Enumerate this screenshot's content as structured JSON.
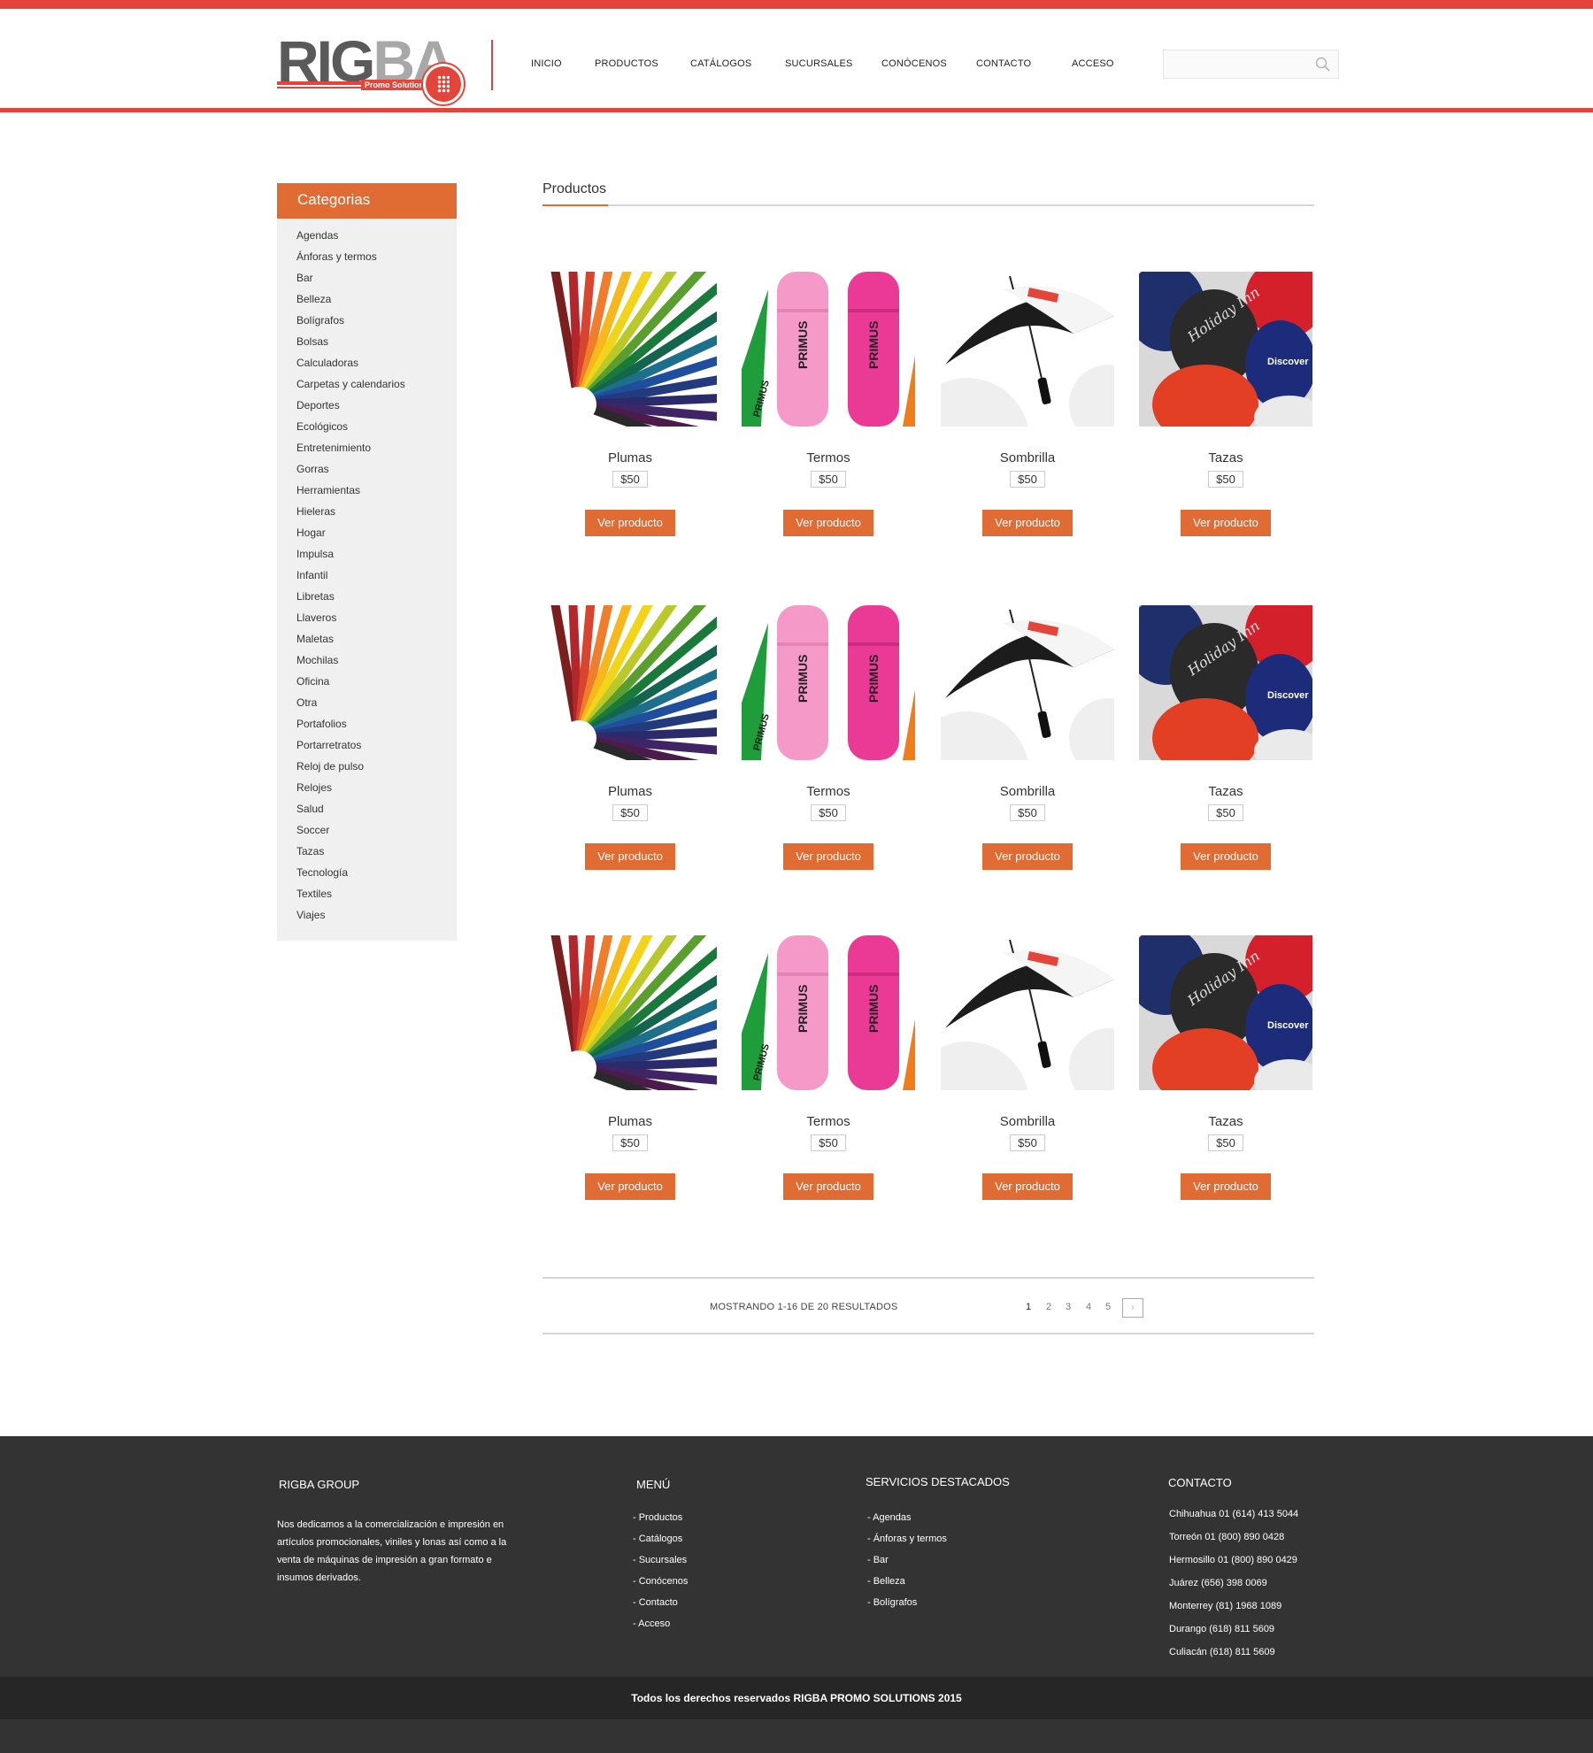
{
  "brand": {
    "name_part1": "RIG",
    "name_part2": "BA",
    "tagline": "Promo Solutions"
  },
  "colors": {
    "accent_red": "#e3453a",
    "accent_orange": "#e06b33",
    "footer_bg": "#333333"
  },
  "nav": {
    "items": [
      "INICIO",
      "PRODUCTOS",
      "CATÁLOGOS",
      "SUCURSALES",
      "CONÓCENOS",
      "CONTACTO",
      "ACCESO"
    ]
  },
  "search": {
    "placeholder": ""
  },
  "sidebar": {
    "title": "Categorias",
    "categories": [
      "Agendas",
      "Ánforas y termos",
      "Bar",
      "Belleza",
      "Bolígrafos",
      "Bolsas",
      "Calculadoras",
      "Carpetas y calendarios",
      "Deportes",
      "Ecológicos",
      "Entretenimiento",
      "Gorras",
      "Herramientas",
      "Hieleras",
      "Hogar",
      "Impulsa",
      "Infantil",
      "Libretas",
      "Llaveros",
      "Maletas",
      "Mochilas",
      "Oficina",
      "Otra",
      "Portafolios",
      "Portarretratos",
      "Reloj de pulso",
      "Relojes",
      "Salud",
      "Soccer",
      "Tazas",
      "Tecnología",
      "Textiles",
      "Viajes"
    ]
  },
  "main": {
    "title": "Productos",
    "button_label": "Ver producto",
    "products": [
      {
        "name": "Plumas",
        "price": "$50",
        "image": "colored-pencils"
      },
      {
        "name": "Termos",
        "price": "$50",
        "image": "pink-thermos"
      },
      {
        "name": "Sombrilla",
        "price": "$50",
        "image": "umbrella"
      },
      {
        "name": "Tazas",
        "price": "$50",
        "image": "mugs"
      },
      {
        "name": "Plumas",
        "price": "$50",
        "image": "colored-pencils"
      },
      {
        "name": "Termos",
        "price": "$50",
        "image": "pink-thermos"
      },
      {
        "name": "Sombrilla",
        "price": "$50",
        "image": "umbrella"
      },
      {
        "name": "Tazas",
        "price": "$50",
        "image": "mugs"
      },
      {
        "name": "Plumas",
        "price": "$50",
        "image": "colored-pencils"
      },
      {
        "name": "Termos",
        "price": "$50",
        "image": "pink-thermos"
      },
      {
        "name": "Sombrilla",
        "price": "$50",
        "image": "umbrella"
      },
      {
        "name": "Tazas",
        "price": "$50",
        "image": "mugs"
      }
    ]
  },
  "pagination": {
    "showing": "MOSTRANDO 1-16 DE 20 RESULTADOS",
    "pages": [
      "1",
      "2",
      "3",
      "4",
      "5"
    ],
    "current": "1",
    "next": "›"
  },
  "footer": {
    "about_title": "RIGBA GROUP",
    "about_text": "Nos dedicamos a la comercialización e impresión en artículos promocionales, viniles y lonas así como a la venta de máquinas de impresión a gran formato e insumos derivados.",
    "menu_title": "MENÚ",
    "menu_items": [
      "- Productos",
      "- Catálogos",
      "- Sucursales",
      "- Conócenos",
      "- Contacto",
      "- Acceso"
    ],
    "services_title": "SERVICIOS DESTACADOS",
    "services_items": [
      "- Agendas",
      "- Ánforas y termos",
      "- Bar",
      "- Belleza",
      "- Bolígrafos"
    ],
    "contact_title": "CONTACTO",
    "contact_items": [
      "Chihuahua 01 (614) 413 5044",
      "Torreón 01 (800) 890 0428",
      "Hermosillo 01 (800) 890 0429",
      "Juárez (656) 398 0069",
      "Monterrey (81) 1968 1089",
      "Durango (618) 811 5609",
      "Culiacán (618) 811 5609"
    ],
    "copyright": "Todos los derechos reservados RIGBA PROMO SOLUTIONS 2015"
  }
}
